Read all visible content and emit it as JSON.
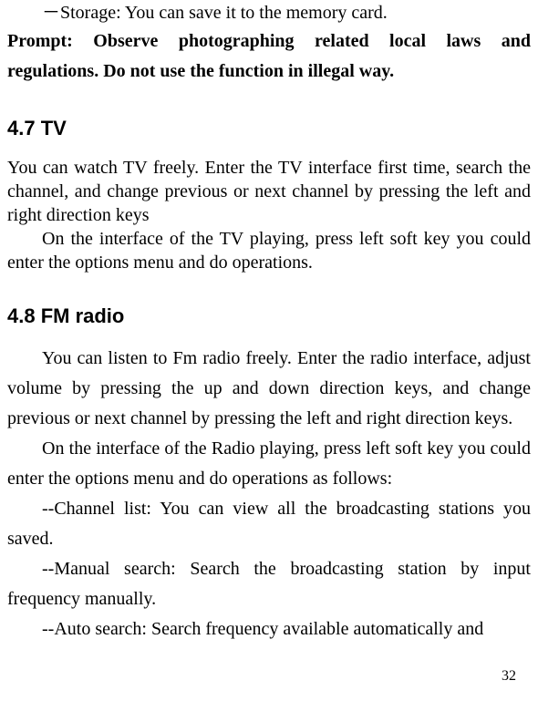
{
  "storage_line": "Storage: You can save it to the memory card.",
  "prompt_text": "Prompt: Observe photographing related local laws and regulations. Do not use the function in illegal way.",
  "section47": {
    "heading": "4.7    TV",
    "p1": "You can watch TV freely. Enter the TV interface first time, search the channel, and change previous or next channel by pressing the left and right direction keys",
    "p2": "On the interface of the TV playing, press left soft key you could enter the options menu and do operations."
  },
  "section48": {
    "heading": "4.8    FM radio",
    "p1": "You can listen to Fm radio freely. Enter the radio interface, adjust volume by pressing the up and down direction keys, and change previous or next channel by pressing the left and right direction keys.",
    "p2": "On the interface of the Radio playing, press left soft key you could enter the options menu and do operations as follows:",
    "p3": "--Channel list: You can view all the broadcasting stations you saved.",
    "p4": "--Manual search: Search the broadcasting station by input frequency manually.",
    "p5": "--Auto search: Search frequency available automatically and"
  },
  "page_number": "32"
}
